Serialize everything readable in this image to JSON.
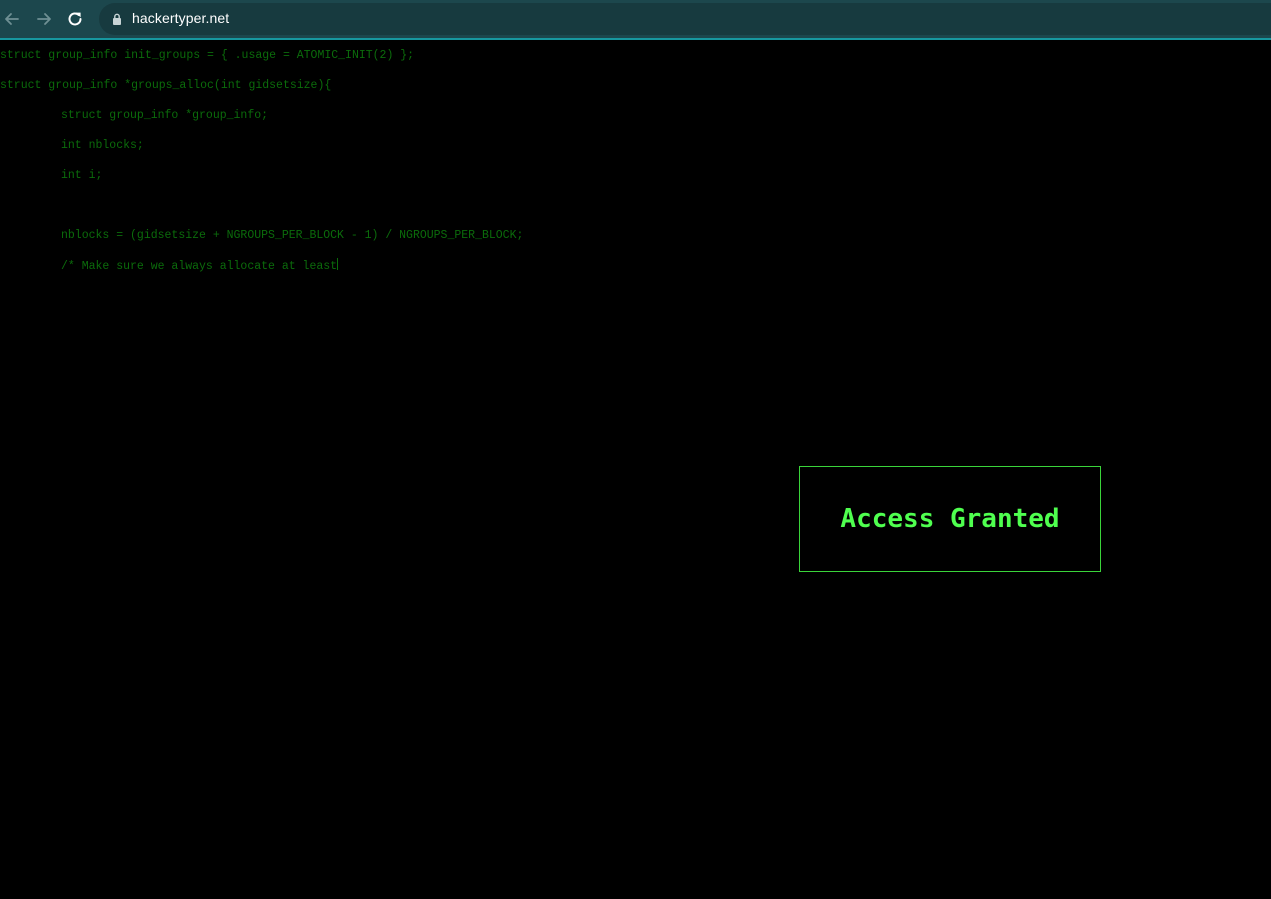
{
  "browser": {
    "url": "hackertyper.net",
    "icons": [
      "back-arrow-icon",
      "forward-arrow-icon",
      "reload-icon",
      "lock-icon"
    ],
    "colors": {
      "toolbar": "#1c474d",
      "accent_line": "#17979f",
      "omnibox": "#173a3f"
    }
  },
  "terminal": {
    "lines": [
      "struct group_info init_groups = { .usage = ATOMIC_INIT(2) };",
      "struct group_info *groups_alloc(int gidsetsize){",
      "struct group_info *group_info;",
      "int nblocks;",
      "int i;",
      "",
      "nblocks = (gidsetsize + NGROUPS_PER_BLOCK - 1) / NGROUPS_PER_BLOCK;",
      "/* Make sure we always allocate at least"
    ],
    "colors": {
      "text": "#0b6b0b",
      "background": "#000000"
    }
  },
  "dialog": {
    "message": "Access Granted",
    "colors": {
      "text": "#4fff4f",
      "border": "#3ad43a"
    }
  }
}
